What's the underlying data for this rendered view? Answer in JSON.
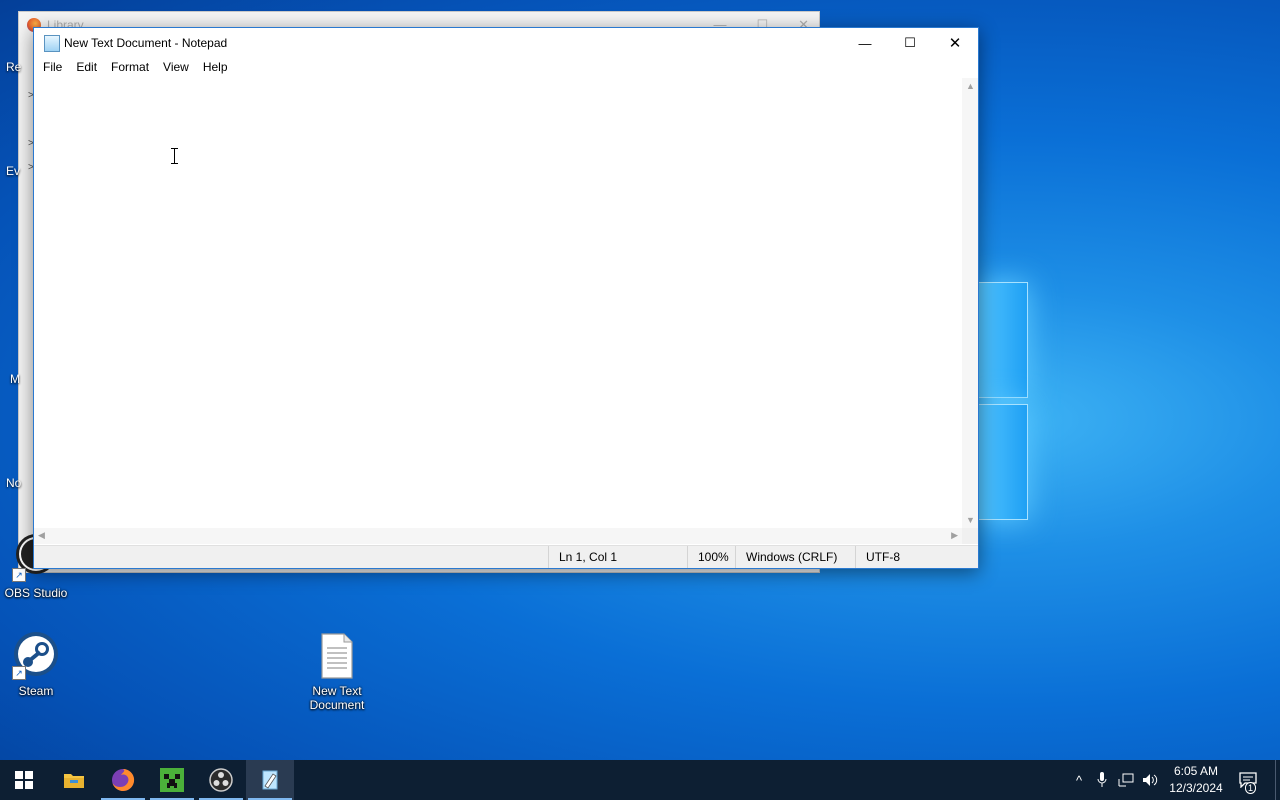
{
  "background_window": {
    "title": "Library",
    "controls": {
      "minimize": "—",
      "maximize": "☐",
      "close": "✕"
    },
    "chevrons": [
      ">",
      ">",
      ">"
    ]
  },
  "desktop_edge_labels": [
    "Re",
    "Ev",
    "M",
    "No"
  ],
  "desktop_icons": [
    {
      "label": "OBS Studio",
      "icon": "obs-icon"
    },
    {
      "label": "Steam",
      "icon": "steam-icon"
    },
    {
      "label": "New Text Document",
      "icon": "text-file-icon"
    }
  ],
  "notepad": {
    "title": "New Text Document - Notepad",
    "controls": {
      "minimize": "—",
      "maximize": "☐",
      "close": "✕"
    },
    "menu": [
      "File",
      "Edit",
      "Format",
      "View",
      "Help"
    ],
    "content": "",
    "status": {
      "position": "Ln 1, Col 1",
      "zoom": "100%",
      "line_ending": "Windows (CRLF)",
      "encoding": "UTF-8"
    }
  },
  "taskbar": {
    "apps": [
      "start-icon",
      "file-explorer-icon",
      "firefox-icon",
      "minecraft-icon",
      "obs-icon",
      "notepad-icon"
    ],
    "active_app": "notepad-icon",
    "tray": {
      "time": "6:05 AM",
      "date": "12/3/2024",
      "notification_count": "1",
      "chevron": "^"
    }
  },
  "colors": {
    "accent": "#2a79d0",
    "taskbar": "#0d1f33",
    "desktop": "#0a6fd6"
  }
}
